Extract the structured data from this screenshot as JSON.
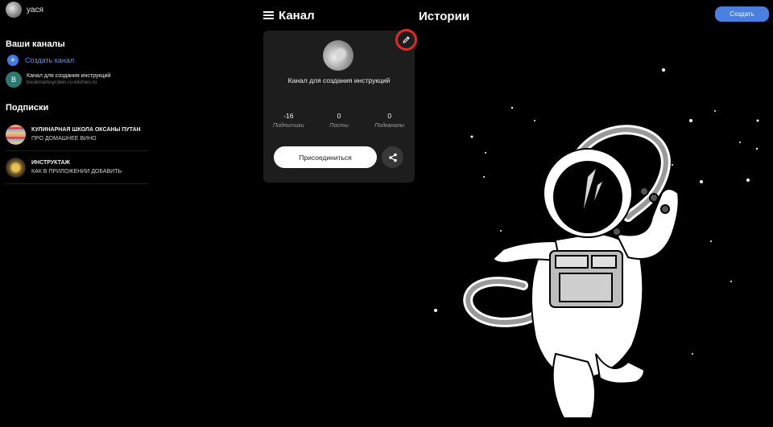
{
  "user": {
    "name": "уася"
  },
  "sidebar": {
    "my_channels_title": "Ваши каналы",
    "create_channel_label": "Создать канал",
    "my_channel": {
      "initial": "B",
      "title": "Канал для создания инструкций",
      "subtitle": "bookmarksyrdeln.ru-kitchen.ru"
    },
    "subscriptions_title": "Подписки",
    "subscriptions": [
      {
        "title": "КУЛИНАРНАЯ ШКОЛА ОКСАНЫ ПУТАН",
        "subtitle": "ПРО ДОМАШНЕЕ ВИНО"
      },
      {
        "title": "ИНСТРУКТАЖ",
        "subtitle": "КАК В ПРИЛОЖЕНИИ ДОБАВИТЬ"
      }
    ]
  },
  "header": {
    "title": "Канал",
    "stories_title": "Истории",
    "create_button": "Создать"
  },
  "card": {
    "name": "Канал для создания инструкций",
    "stats": [
      {
        "value": "-16",
        "label": "Подписчики"
      },
      {
        "value": "0",
        "label": "Посты"
      },
      {
        "value": "0",
        "label": "Подканалы"
      }
    ],
    "join_button": "Присоединиться"
  },
  "icons": {
    "menu": "hamburger-icon",
    "share": "share-icon",
    "edit": "pencil-icon",
    "add": "plus-icon"
  },
  "colors": {
    "accent": "#4a7fdf",
    "highlight_ring": "#e32828",
    "card_bg": "#1d1d1d"
  }
}
